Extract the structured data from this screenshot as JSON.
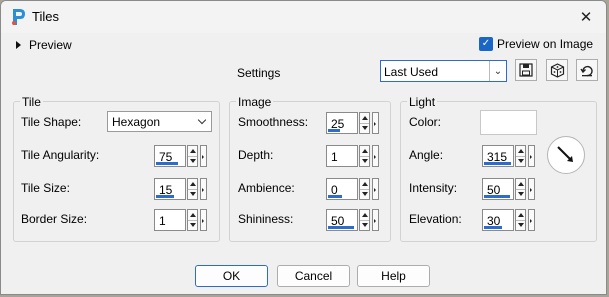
{
  "window": {
    "title": "Tiles"
  },
  "preview": {
    "label": "Preview",
    "preview_on_image": "Preview on Image",
    "checked": true
  },
  "settings": {
    "label": "Settings",
    "preset_value": "Last Used"
  },
  "tile": {
    "title": "Tile",
    "shape_label": "Tile Shape:",
    "shape_value": "Hexagon",
    "angularity_label": "Tile Angularity:",
    "angularity_value": "75",
    "size_label": "Tile Size:",
    "size_value": "15",
    "border_label": "Border Size:",
    "border_value": "1"
  },
  "image": {
    "title": "Image",
    "smoothness_label": "Smoothness:",
    "smoothness_value": "25",
    "depth_label": "Depth:",
    "depth_value": "1",
    "ambience_label": "Ambience:",
    "ambience_value": "0",
    "shininess_label": "Shininess:",
    "shininess_value": "50"
  },
  "light": {
    "title": "Light",
    "color_label": "Color:",
    "angle_label": "Angle:",
    "angle_value": "315",
    "intensity_label": "Intensity:",
    "intensity_value": "50",
    "elevation_label": "Elevation:",
    "elevation_value": "30"
  },
  "buttons": {
    "ok": "OK",
    "cancel": "Cancel",
    "help": "Help"
  },
  "colors": {
    "accent": "#2d6ccd",
    "checkbox": "#1a66c6",
    "light_color": "#ffffff"
  }
}
